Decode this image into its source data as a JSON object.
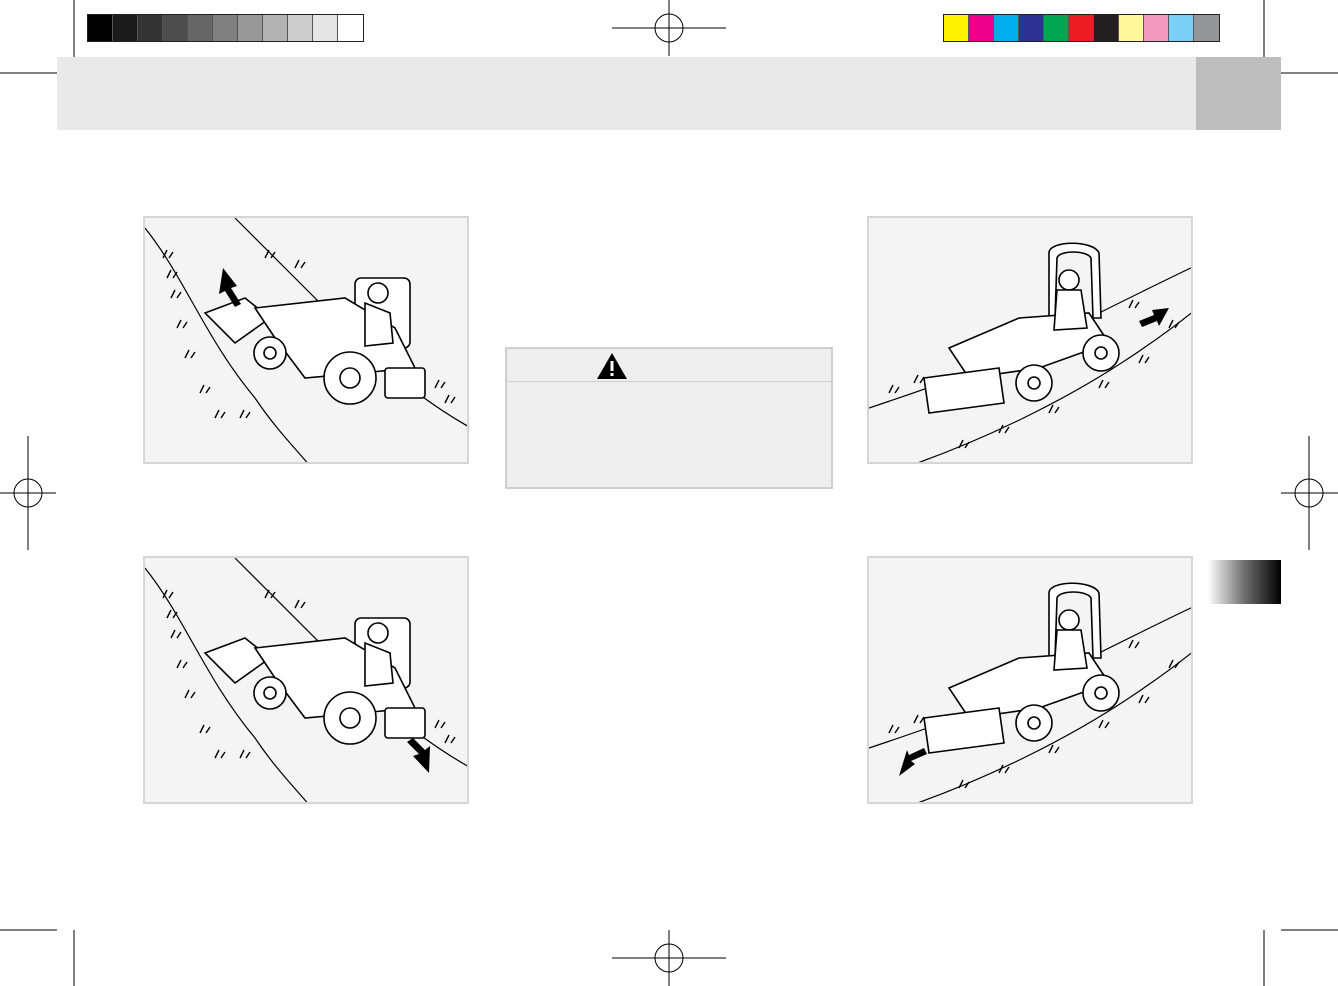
{
  "print_marks": {
    "grayscale_swatches": [
      "#000000",
      "#1a1a1a",
      "#333333",
      "#4d4d4d",
      "#666666",
      "#808080",
      "#999999",
      "#b3b3b3",
      "#cccccc",
      "#e6e6e6",
      "#ffffff"
    ],
    "color_swatches": [
      "#fff200",
      "#ec008c",
      "#00aeef",
      "#2e3192",
      "#00a651",
      "#ed1c24",
      "#231f20",
      "#fff799",
      "#f49ac1",
      "#7dd0f5",
      "#939598"
    ]
  },
  "header": {
    "band_color": "#e9e9e9",
    "tab_color": "#bdbdbd"
  },
  "warning": {
    "icon": "warning-triangle-icon"
  },
  "figures": [
    {
      "id": "slope-up-side-view",
      "arrow": "up"
    },
    {
      "id": "slope-down-side-view",
      "arrow": "down"
    },
    {
      "id": "slope-up-front-view",
      "arrow": "up"
    },
    {
      "id": "slope-down-front-view",
      "arrow": "down"
    }
  ]
}
